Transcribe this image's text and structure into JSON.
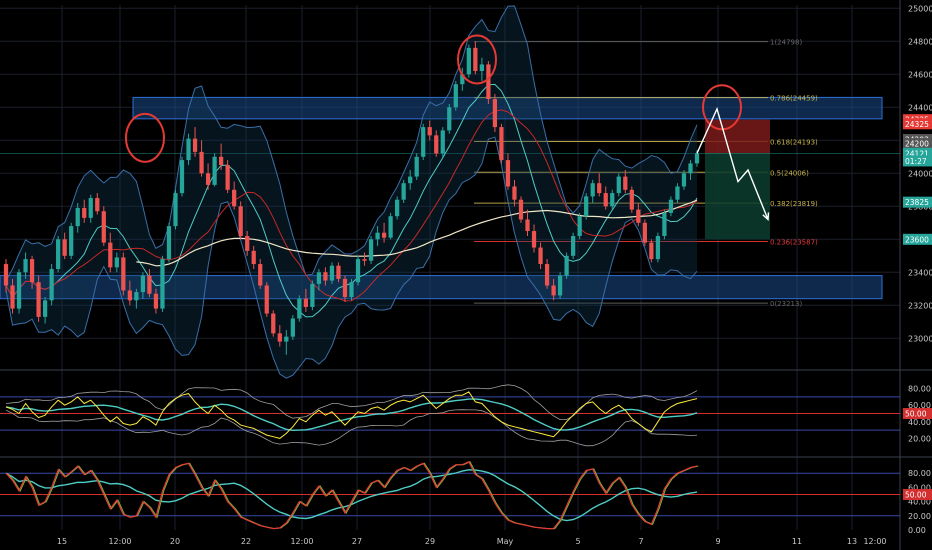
{
  "colors": {
    "background": "#000000",
    "grid": "#1a1f2b",
    "up": "#26a69a",
    "down": "#ef5350",
    "zone_fill": "#1a4a8a",
    "zone_stroke": "#2f6fd6",
    "ema_long": "#f0e6c8",
    "ema_short": "#c62828",
    "band": "#3a6ea8",
    "mid": "#4ecdc4",
    "fib": "#c9b44a",
    "fib_red": "#e53935",
    "rsi": "#ffeb3b",
    "stoch_red": "#e53935",
    "stoch_green": "#7cb342",
    "level_red": "#d32f2f",
    "level_blue": "#3949ab",
    "circle": "#e53935",
    "projection": "#ffffff",
    "target_fill": "#0b3d2e",
    "stop_fill": "#7a1a1a",
    "axis_text": "#c8c8c8"
  },
  "chart_data": [
    {
      "type": "candlestick",
      "name": "price",
      "ylim": [
        22820,
        25020
      ],
      "x_ticks": [
        "15",
        "12:00",
        "20",
        "22",
        "12:00",
        "27",
        "29",
        "May",
        "5",
        "7",
        "9",
        "11",
        "13",
        "12:00"
      ],
      "y_ticks": [
        23000,
        23200,
        23400,
        23600,
        23800,
        24000,
        24200,
        24400,
        24600,
        24800,
        25000
      ],
      "ohlc": [
        [
          23450,
          23480,
          23280,
          23320
        ],
        [
          23320,
          23360,
          23150,
          23180
        ],
        [
          23180,
          23420,
          23150,
          23400
        ],
        [
          23400,
          23520,
          23360,
          23480
        ],
        [
          23480,
          23500,
          23300,
          23340
        ],
        [
          23340,
          23380,
          23100,
          23130
        ],
        [
          23130,
          23250,
          23090,
          23230
        ],
        [
          23230,
          23450,
          23200,
          23420
        ],
        [
          23420,
          23620,
          23400,
          23600
        ],
        [
          23600,
          23640,
          23480,
          23500
        ],
        [
          23500,
          23700,
          23480,
          23680
        ],
        [
          23680,
          23820,
          23640,
          23790
        ],
        [
          23790,
          23840,
          23700,
          23730
        ],
        [
          23730,
          23870,
          23700,
          23850
        ],
        [
          23850,
          23880,
          23750,
          23770
        ],
        [
          23770,
          23800,
          23560,
          23580
        ],
        [
          23580,
          23640,
          23400,
          23430
        ],
        [
          23430,
          23520,
          23400,
          23490
        ],
        [
          23490,
          23520,
          23260,
          23290
        ],
        [
          23290,
          23350,
          23200,
          23230
        ],
        [
          23230,
          23300,
          23180,
          23280
        ],
        [
          23280,
          23400,
          23240,
          23380
        ],
        [
          23380,
          23420,
          23250,
          23270
        ],
        [
          23270,
          23300,
          23150,
          23180
        ],
        [
          23180,
          23500,
          23160,
          23480
        ],
        [
          23480,
          23700,
          23460,
          23680
        ],
        [
          23680,
          23900,
          23660,
          23880
        ],
        [
          23880,
          24100,
          23860,
          24080
        ],
        [
          24080,
          24240,
          24050,
          24210
        ],
        [
          24210,
          24280,
          24100,
          24130
        ],
        [
          24130,
          24200,
          23980,
          24000
        ],
        [
          24000,
          24060,
          23900,
          23930
        ],
        [
          23930,
          24120,
          23920,
          24100
        ],
        [
          24100,
          24180,
          24020,
          24050
        ],
        [
          24050,
          24080,
          23880,
          23900
        ],
        [
          23900,
          23950,
          23780,
          23800
        ],
        [
          23800,
          23830,
          23600,
          23620
        ],
        [
          23620,
          23650,
          23500,
          23530
        ],
        [
          23530,
          23560,
          23420,
          23450
        ],
        [
          23450,
          23480,
          23300,
          23320
        ],
        [
          23320,
          23340,
          23130,
          23150
        ],
        [
          23150,
          23170,
          23010,
          23030
        ],
        [
          23030,
          23080,
          22950,
          22980
        ],
        [
          22980,
          23050,
          22900,
          23010
        ],
        [
          23010,
          23140,
          22990,
          23120
        ],
        [
          23120,
          23260,
          23100,
          23240
        ],
        [
          23240,
          23300,
          23160,
          23190
        ],
        [
          23190,
          23350,
          23170,
          23330
        ],
        [
          23330,
          23420,
          23290,
          23400
        ],
        [
          23400,
          23430,
          23320,
          23350
        ],
        [
          23350,
          23460,
          23330,
          23440
        ],
        [
          23440,
          23460,
          23340,
          23360
        ],
        [
          23360,
          23380,
          23220,
          23250
        ],
        [
          23250,
          23360,
          23230,
          23340
        ],
        [
          23340,
          23500,
          23320,
          23480
        ],
        [
          23480,
          23520,
          23440,
          23470
        ],
        [
          23470,
          23620,
          23450,
          23600
        ],
        [
          23600,
          23680,
          23560,
          23640
        ],
        [
          23640,
          23700,
          23580,
          23610
        ],
        [
          23610,
          23760,
          23600,
          23740
        ],
        [
          23740,
          23860,
          23720,
          23840
        ],
        [
          23840,
          23960,
          23820,
          23940
        ],
        [
          23940,
          24020,
          23900,
          23980
        ],
        [
          23980,
          24120,
          23960,
          24100
        ],
        [
          24100,
          24300,
          24080,
          24280
        ],
        [
          24280,
          24320,
          24200,
          24230
        ],
        [
          24230,
          24260,
          24100,
          24120
        ],
        [
          24120,
          24280,
          24100,
          24260
        ],
        [
          24260,
          24420,
          24240,
          24400
        ],
        [
          24400,
          24560,
          24380,
          24540
        ],
        [
          24540,
          24640,
          24500,
          24600
        ],
        [
          24600,
          24780,
          24580,
          24760
        ],
        [
          24760,
          24800,
          24600,
          24620
        ],
        [
          24620,
          24700,
          24560,
          24660
        ],
        [
          24660,
          24680,
          24420,
          24450
        ],
        [
          24450,
          24480,
          24250,
          24280
        ],
        [
          24280,
          24300,
          24060,
          24080
        ],
        [
          24080,
          24120,
          23900,
          23920
        ],
        [
          23920,
          23960,
          23800,
          23840
        ],
        [
          23840,
          23860,
          23700,
          23720
        ],
        [
          23720,
          23780,
          23620,
          23650
        ],
        [
          23650,
          23690,
          23520,
          23550
        ],
        [
          23550,
          23580,
          23420,
          23450
        ],
        [
          23450,
          23480,
          23300,
          23320
        ],
        [
          23320,
          23360,
          23230,
          23260
        ],
        [
          23260,
          23400,
          23240,
          23380
        ],
        [
          23380,
          23520,
          23360,
          23500
        ],
        [
          23500,
          23640,
          23480,
          23620
        ],
        [
          23620,
          23760,
          23600,
          23740
        ],
        [
          23740,
          23880,
          23720,
          23860
        ],
        [
          23860,
          23960,
          23820,
          23940
        ],
        [
          23940,
          24000,
          23860,
          23880
        ],
        [
          23880,
          23920,
          23780,
          23800
        ],
        [
          23800,
          23900,
          23780,
          23880
        ],
        [
          23880,
          24000,
          23860,
          23980
        ],
        [
          23980,
          24020,
          23880,
          23900
        ],
        [
          23900,
          23920,
          23760,
          23780
        ],
        [
          23780,
          23820,
          23680,
          23700
        ],
        [
          23700,
          23720,
          23560,
          23580
        ],
        [
          23580,
          23600,
          23460,
          23480
        ],
        [
          23480,
          23640,
          23460,
          23620
        ],
        [
          23620,
          23780,
          23600,
          23760
        ],
        [
          23760,
          23860,
          23740,
          23840
        ],
        [
          23840,
          23940,
          23820,
          23920
        ],
        [
          23920,
          24020,
          23900,
          24000
        ],
        [
          24000,
          24080,
          23960,
          24060
        ],
        [
          24060,
          24140,
          24040,
          24121
        ]
      ]
    },
    {
      "type": "line",
      "name": "rsi",
      "ylim": [
        0,
        100
      ],
      "y_ticks": [
        20.0,
        40.0,
        60.0,
        80.0
      ],
      "values": [
        58,
        55,
        50,
        62,
        52,
        45,
        48,
        58,
        66,
        60,
        64,
        70,
        62,
        66,
        58,
        48,
        40,
        46,
        38,
        36,
        38,
        46,
        42,
        36,
        52,
        62,
        68,
        72,
        74,
        64,
        56,
        50,
        60,
        54,
        46,
        42,
        36,
        34,
        32,
        28,
        24,
        22,
        20,
        26,
        34,
        44,
        40,
        48,
        54,
        48,
        52,
        44,
        36,
        44,
        52,
        50,
        56,
        58,
        54,
        60,
        64,
        66,
        64,
        68,
        72,
        64,
        56,
        62,
        68,
        72,
        72,
        76,
        64,
        62,
        54,
        46,
        40,
        36,
        34,
        32,
        30,
        28,
        26,
        24,
        22,
        30,
        40,
        48,
        56,
        62,
        64,
        56,
        50,
        56,
        60,
        54,
        44,
        38,
        32,
        28,
        40,
        52,
        58,
        62,
        64,
        66,
        68
      ]
    },
    {
      "type": "line",
      "name": "stochastic",
      "ylim": [
        0,
        100
      ],
      "y_ticks": [
        0.0,
        20.0,
        40.0,
        60.0,
        80.0
      ],
      "values": [
        80,
        70,
        55,
        75,
        60,
        35,
        40,
        60,
        85,
        75,
        82,
        90,
        78,
        84,
        70,
        50,
        30,
        42,
        22,
        18,
        20,
        40,
        32,
        18,
        55,
        78,
        88,
        92,
        94,
        78,
        60,
        48,
        70,
        58,
        40,
        30,
        18,
        14,
        10,
        6,
        4,
        2,
        3,
        10,
        24,
        40,
        34,
        50,
        62,
        48,
        56,
        40,
        24,
        40,
        56,
        52,
        66,
        70,
        60,
        74,
        84,
        88,
        84,
        90,
        94,
        80,
        60,
        72,
        86,
        92,
        92,
        96,
        78,
        72,
        56,
        38,
        24,
        14,
        10,
        8,
        6,
        4,
        3,
        2,
        2,
        14,
        34,
        54,
        72,
        84,
        86,
        66,
        52,
        66,
        74,
        60,
        36,
        22,
        12,
        8,
        30,
        58,
        72,
        80,
        84,
        88,
        90
      ]
    }
  ],
  "fib_levels": [
    {
      "ratio": 1,
      "value": 24798,
      "label": "1(24798)"
    },
    {
      "ratio": 0.786,
      "value": 24459,
      "label": "0.786(24459)"
    },
    {
      "ratio": 0.618,
      "value": 24193,
      "label": "0.618(24193)"
    },
    {
      "ratio": 0.5,
      "value": 24006,
      "label": "0.5(24006)"
    },
    {
      "ratio": 0.382,
      "value": 23819,
      "label": "0.382(23819)"
    },
    {
      "ratio": 0.236,
      "value": 23587,
      "label": "0.236(23587)"
    },
    {
      "ratio": 0,
      "value": 23213,
      "label": "0(23213)"
    }
  ],
  "zones": [
    {
      "name": "resistance-zone",
      "top": 24460,
      "bottom": 24330
    },
    {
      "name": "support-zone",
      "top": 23380,
      "bottom": 23240
    }
  ],
  "price_badges": [
    {
      "label": "24325",
      "value": 24325,
      "color": "#e53935"
    },
    {
      "label": "24325",
      "value": 24300,
      "color": "#e53935"
    },
    {
      "label": "24203",
      "value": 24205,
      "color": "#555555"
    },
    {
      "label": "24200",
      "value": 24180,
      "color": "#555555"
    },
    {
      "label": "24121",
      "value": 24121,
      "color": "#26a69a"
    },
    {
      "label": "01:27",
      "value": 24075,
      "color": "#26a69a"
    },
    {
      "label": "23825",
      "value": 23825,
      "color": "#26a69a"
    },
    {
      "label": "23600",
      "value": 23600,
      "color": "#26a69a"
    }
  ],
  "rsi_badge": "50.00",
  "stoch_badge": "50.00"
}
